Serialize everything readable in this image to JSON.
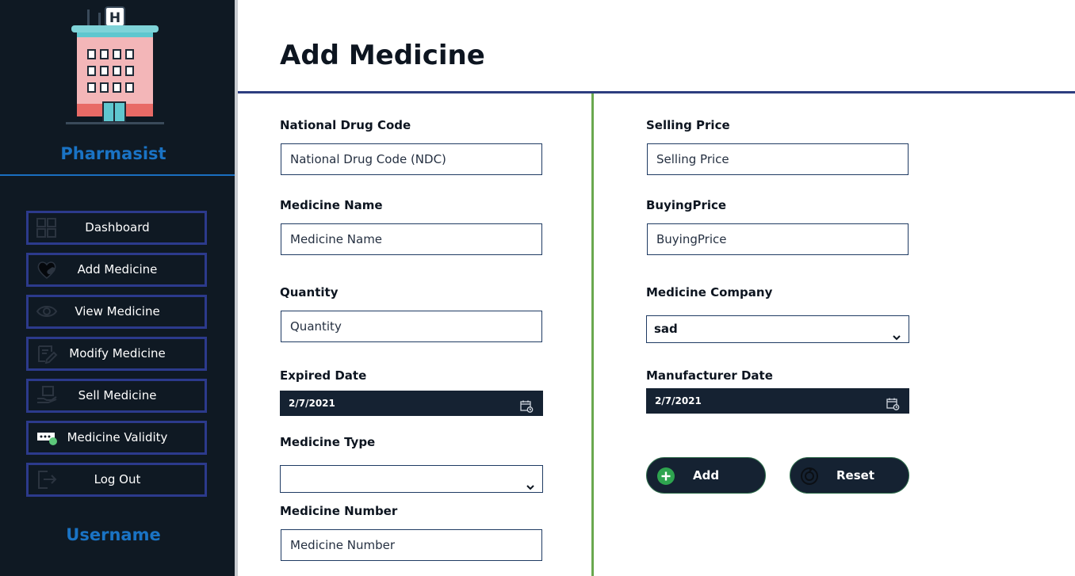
{
  "sidebar": {
    "role": "Pharmasist",
    "username": "Username",
    "items": [
      {
        "label": "Dashboard",
        "icon": "grid-icon"
      },
      {
        "label": "Add Medicine",
        "icon": "heart-pill-icon"
      },
      {
        "label": "View Medicine",
        "icon": "eye-icon"
      },
      {
        "label": "Modify Medicine",
        "icon": "edit-icon"
      },
      {
        "label": "Sell Medicine",
        "icon": "sell-icon"
      },
      {
        "label": "Medicine Validity",
        "icon": "validity-icon"
      },
      {
        "label": "Log Out",
        "icon": "logout-icon"
      }
    ],
    "logo_letter": "H"
  },
  "main": {
    "title": "Add Medicine",
    "left": {
      "ndc": {
        "label": "National Drug Code",
        "placeholder": "National Drug Code (NDC)"
      },
      "name": {
        "label": "Medicine Name",
        "placeholder": "Medicine Name"
      },
      "quantity": {
        "label": "Quantity",
        "placeholder": "Quantity"
      },
      "expired": {
        "label": "Expired Date",
        "value": "2/7/2021"
      },
      "type": {
        "label": "Medicine Type",
        "value": ""
      },
      "number": {
        "label": "Medicine Number",
        "placeholder": "Medicine Number"
      }
    },
    "right": {
      "selling": {
        "label": "Selling Price",
        "placeholder": "Selling Price"
      },
      "buying": {
        "label": "BuyingPrice",
        "placeholder": "BuyingPrice"
      },
      "company": {
        "label": "Medicine Company",
        "value": "sad"
      },
      "manufacturer": {
        "label": "Manufacturer Date",
        "value": "2/7/2021"
      },
      "add_label": "Add",
      "reset_label": "Reset"
    }
  },
  "colors": {
    "sidebar_bg": "#0f1923",
    "accent_blue": "#1a73c4",
    "nav_border": "#2c3a8c",
    "divider_green": "#6aa84f",
    "button_bg": "#152232",
    "add_icon_green": "#2ea44f"
  }
}
